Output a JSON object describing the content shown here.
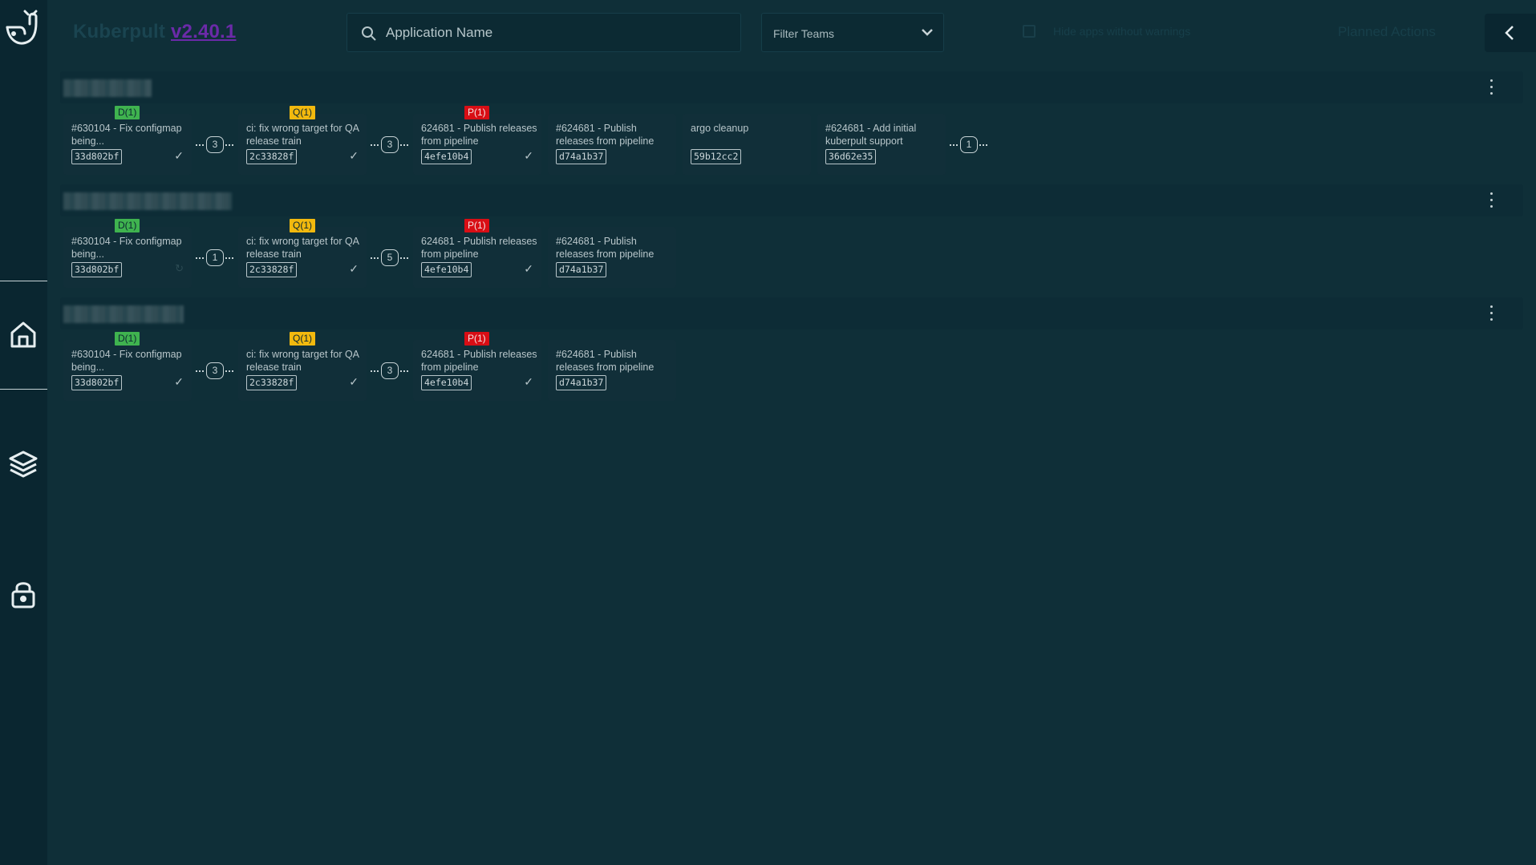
{
  "app": {
    "name": "Kuberpult",
    "version": "v2.40.1"
  },
  "search": {
    "placeholder": "Application Name"
  },
  "filter": {
    "label": "Filter Teams"
  },
  "hide_apps": {
    "label": "Hide apps without warnings"
  },
  "planned_actions": {
    "label": "Planned Actions"
  },
  "icons": {
    "logo": "whale-logo-icon",
    "search": "search-icon",
    "chevron": "chevron-down-icon",
    "collapse": "chevron-left-icon",
    "home": "home-icon",
    "layers": "layers-icon",
    "lock": "lock-icon"
  },
  "colors": {
    "background": "#0f2f38",
    "sidebar": "#0a2630",
    "badge_d": "#3fb34f",
    "badge_q": "#f2b90e",
    "badge_p": "#d80e15"
  },
  "groups": [
    {
      "cards": [
        {
          "badge": "D(1)",
          "title": "#630104 - Fix configmap being...",
          "sha": "33d802bf",
          "status": "✓"
        },
        {
          "badge": "Q(1)",
          "title": "ci: fix wrong target for QA release train",
          "sha": "2c33828f",
          "status": "✓"
        },
        {
          "badge": "P(1)",
          "title": "624681 - Publish releases from pipeline",
          "sha": "4efe10b4",
          "status": "✓"
        },
        {
          "badge": "",
          "title": "#624681 - Publish releases from pipeline",
          "sha": "d74a1b37",
          "status": ""
        },
        {
          "badge": "",
          "title": "argo cleanup",
          "sha": "59b12cc2",
          "status": ""
        },
        {
          "badge": "",
          "title": "#624681 - Add initial kuberpult support",
          "sha": "36d62e35",
          "status": ""
        }
      ],
      "connectors": [
        "3",
        "3"
      ],
      "trailing": "1"
    },
    {
      "cards": [
        {
          "badge": "D(1)",
          "title": "#630104 - Fix configmap being...",
          "sha": "33d802bf",
          "status": "↻"
        },
        {
          "badge": "Q(1)",
          "title": "ci: fix wrong target for QA release train",
          "sha": "2c33828f",
          "status": "✓"
        },
        {
          "badge": "P(1)",
          "title": "624681 - Publish releases from pipeline",
          "sha": "4efe10b4",
          "status": "✓"
        },
        {
          "badge": "",
          "title": "#624681 - Publish releases from pipeline",
          "sha": "d74a1b37",
          "status": ""
        }
      ],
      "connectors": [
        "1",
        "5"
      ]
    },
    {
      "cards": [
        {
          "badge": "D(1)",
          "title": "#630104 - Fix configmap being...",
          "sha": "33d802bf",
          "status": "✓"
        },
        {
          "badge": "Q(1)",
          "title": "ci: fix wrong target for QA release train",
          "sha": "2c33828f",
          "status": "✓"
        },
        {
          "badge": "P(1)",
          "title": "624681 - Publish releases from pipeline",
          "sha": "4efe10b4",
          "status": "✓"
        },
        {
          "badge": "",
          "title": "#624681 - Publish releases from pipeline",
          "sha": "d74a1b37",
          "status": ""
        }
      ],
      "connectors": [
        "3",
        "3"
      ]
    }
  ]
}
